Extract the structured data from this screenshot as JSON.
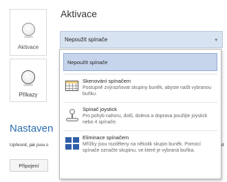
{
  "left_panel": {
    "activate_label": "Aktivace",
    "prikazy_label": "Příkazy"
  },
  "section": {
    "title": "Aktivace",
    "dropdown_value": "Nepoužít spínače"
  },
  "settings": {
    "heading": "Nastaven",
    "description": "Upřesnit, jak jsou s",
    "description_tail": "ed",
    "connect_button": "Připojení"
  },
  "menu": {
    "selected": "Nepoužít spínače",
    "items": [
      {
        "title": "Skenování spínačem",
        "desc": "Postupně zvýrazňovat skupiny buněk, abyste našli vybranou buňku.",
        "icon": "grid-scan-icon"
      },
      {
        "title": "Spínač joystick",
        "desc": "Pro pohyb nahoru, dolů, doleva a doprava použijte joystick nebo 4 spínače.",
        "icon": "joystick-icon"
      },
      {
        "title": "Eliminace spínačem",
        "desc": "Mřížky jsou rozděleny na několik skupin buněk. Pomocí spínače označte skupinu, ve které je vybraná buňka.",
        "icon": "grid-blocks-icon"
      }
    ]
  },
  "colors": {
    "accent": "#2b6cae",
    "dropdown_bg": "#d8e3f2",
    "selected_bg": "#c7d5ec",
    "icon_blue": "#2f5fa8"
  }
}
